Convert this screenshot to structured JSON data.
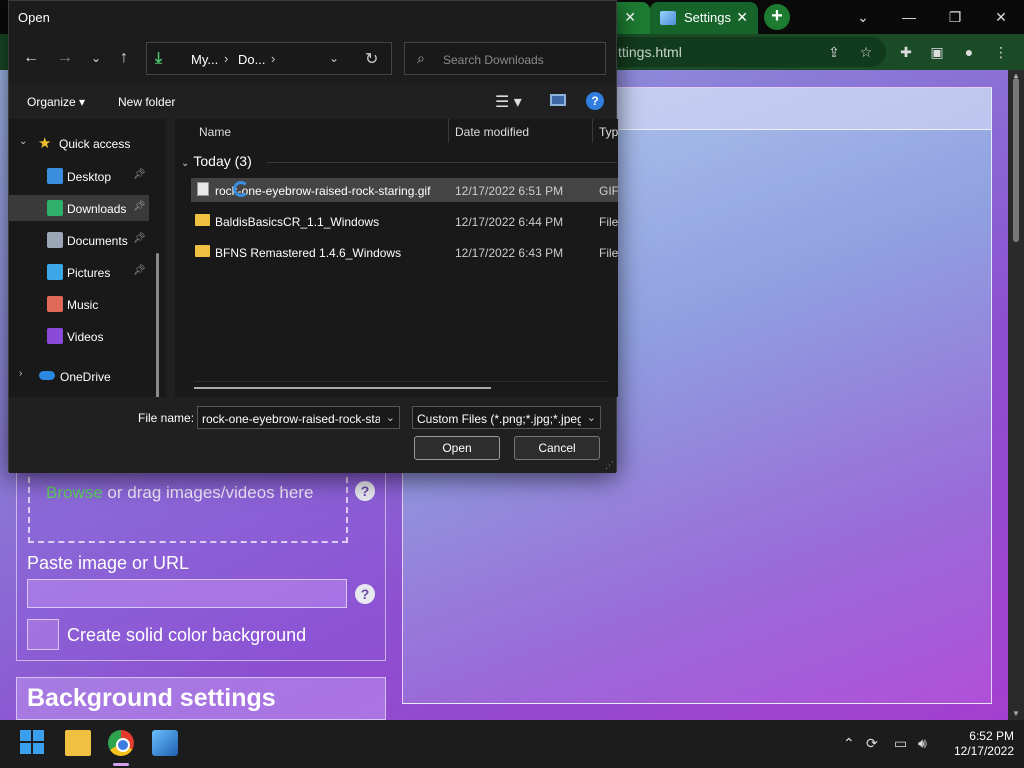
{
  "browser": {
    "tab_title": "Settings",
    "url_fragment": "ttings.html"
  },
  "app": {
    "dropzone_browse": "Browse",
    "dropzone_rest": " or drag images/videos here",
    "paste_label": "Paste image or URL",
    "solid_color_label": "Create solid color background",
    "background_settings_title": "Background settings"
  },
  "dialog": {
    "title": "Open",
    "address": {
      "crumbs": [
        "My...",
        "Do..."
      ]
    },
    "search_placeholder": "Search Downloads",
    "commands": {
      "organize": "Organize ▾",
      "new_folder": "New folder"
    },
    "nav": {
      "quick_access": "Quick access",
      "items": [
        {
          "label": "Desktop",
          "color": "#3c8ee0",
          "pinned": true
        },
        {
          "label": "Downloads",
          "color": "#2fb06a",
          "pinned": true,
          "selected": true
        },
        {
          "label": "Documents",
          "color": "#9aa5b5",
          "pinned": true
        },
        {
          "label": "Pictures",
          "color": "#3ba6e8",
          "pinned": true
        },
        {
          "label": "Music",
          "color": "#e06a5a",
          "pinned": false
        },
        {
          "label": "Videos",
          "color": "#8a4ad8",
          "pinned": false
        }
      ],
      "onedrive": "OneDrive"
    },
    "columns": {
      "name": "Name",
      "date": "Date modified",
      "type": "Type"
    },
    "group": "Today (3)",
    "files": [
      {
        "name": "rock-one-eyebrow-raised-rock-staring.gif",
        "date": "12/17/2022 6:51 PM",
        "type": "GIF F",
        "kind": "file",
        "selected": true
      },
      {
        "name": "BaldisBasicsCR_1.1_Windows",
        "date": "12/17/2022 6:44 PM",
        "type": "File fo",
        "kind": "folder",
        "selected": false
      },
      {
        "name": "BFNS Remastered 1.4.6_Windows",
        "date": "12/17/2022 6:43 PM",
        "type": "File fo",
        "kind": "folder",
        "selected": false
      }
    ],
    "file_name_label": "File name:",
    "file_name_value": "rock-one-eyebrow-raised-rock-staring.gif",
    "file_type_value": "Custom Files (*.png;*.jpg;*.jpeg",
    "open_label": "Open",
    "cancel_label": "Cancel"
  },
  "taskbar": {
    "time": "6:52 PM",
    "date": "12/17/2022"
  }
}
